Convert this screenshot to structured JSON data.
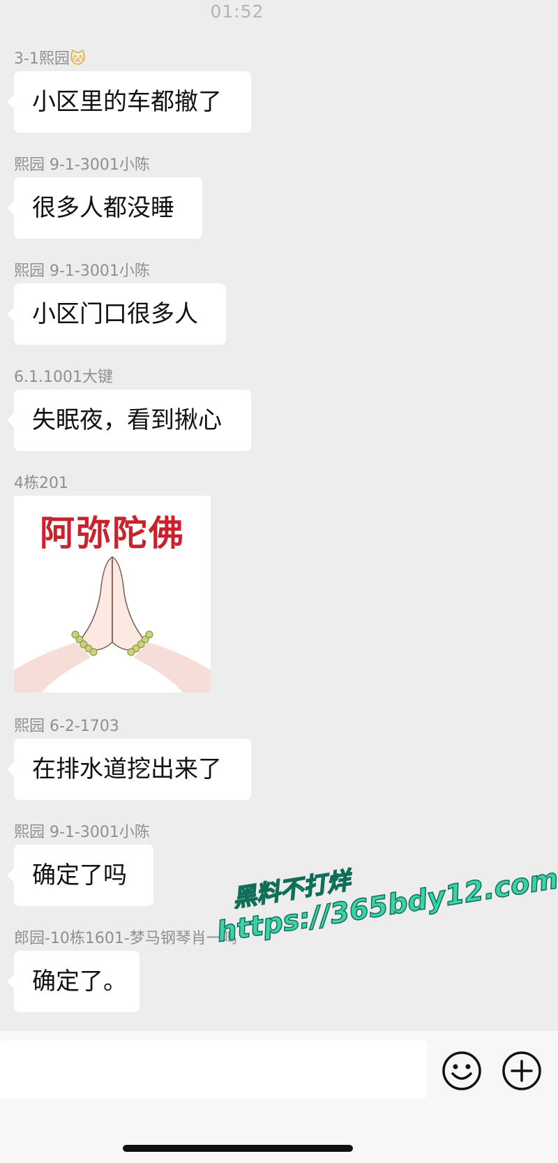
{
  "status": {
    "time": "01:52"
  },
  "messages": [
    {
      "sender": "3-1熙园",
      "sender_emoji": "🐱",
      "text": "小区里的车都撤了"
    },
    {
      "sender": "熙园 9-1-3001小陈",
      "text": "很多人都没睡"
    },
    {
      "sender": "熙园 9-1-3001小陈",
      "text": "小区门口很多人"
    },
    {
      "sender": "6.1.1001大键",
      "text": "失眠夜，看到揪心"
    },
    {
      "sender": "4栋201",
      "sticker_text": "阿弥陀佛"
    },
    {
      "sender": "熙园 6-2-1703",
      "text": "在排水道挖出来了"
    },
    {
      "sender": "熙园 9-1-3001小陈",
      "text": "确定了吗"
    },
    {
      "sender": "郎园-10栋1601-梦马钢琴肖一鸣",
      "text": "确定了。"
    }
  ],
  "watermark": {
    "line1": "黑料不打烊",
    "line2": "https://365bdy12.com"
  },
  "input_bar": {
    "placeholder": "",
    "emoji_icon": "smiley-face-icon",
    "add_icon": "plus-circle-icon"
  },
  "colors": {
    "chat_background": "#ededed",
    "bubble": "#ffffff",
    "sender_text": "#8f8f8f",
    "watermark": "#3ed1a8",
    "sticker_title": "#c8232c"
  }
}
